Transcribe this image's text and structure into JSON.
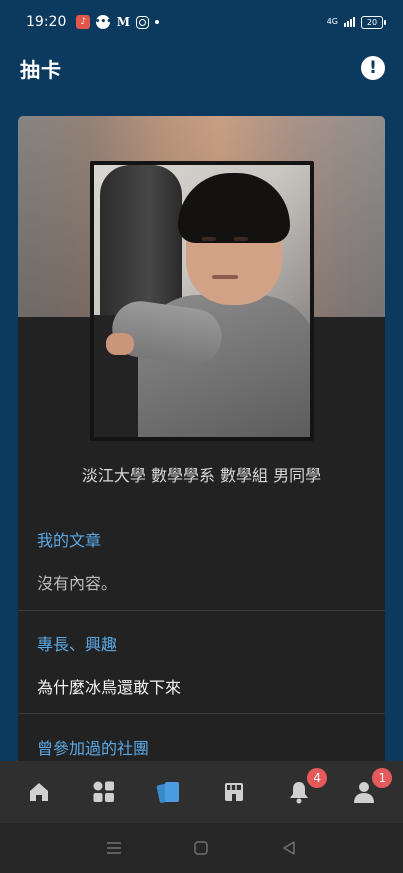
{
  "status_bar": {
    "time": "19:20",
    "apps": [
      "music-icon",
      "line-icon",
      "m-icon",
      "instagram-icon"
    ],
    "network": "4G",
    "battery": "20"
  },
  "header": {
    "title": "抽卡",
    "action_icon": "alert-icon"
  },
  "card": {
    "school_line": "淡江大學 數學學系 數學組 男同學",
    "sections": [
      {
        "title": "我的文章",
        "body": "沒有內容。"
      },
      {
        "title": "專長、興趣",
        "body": "為什麼冰鳥還敢下來"
      },
      {
        "title": "曾參加過的社團",
        "body": ""
      }
    ]
  },
  "bottom_nav": {
    "items": [
      {
        "name": "home",
        "icon": "home-icon",
        "badge": ""
      },
      {
        "name": "boards",
        "icon": "grid-icon",
        "badge": ""
      },
      {
        "name": "cards",
        "icon": "cards-icon",
        "badge": "",
        "active": true
      },
      {
        "name": "shop",
        "icon": "store-icon",
        "badge": ""
      },
      {
        "name": "notifications",
        "icon": "bell-icon",
        "badge": "4"
      },
      {
        "name": "profile",
        "icon": "person-icon",
        "badge": "1"
      }
    ]
  },
  "colors": {
    "background": "#0c3a5e",
    "card": "#222222",
    "accent": "#5aa9e6",
    "badge": "#e55a5a",
    "nav": "#2f2f2f"
  }
}
